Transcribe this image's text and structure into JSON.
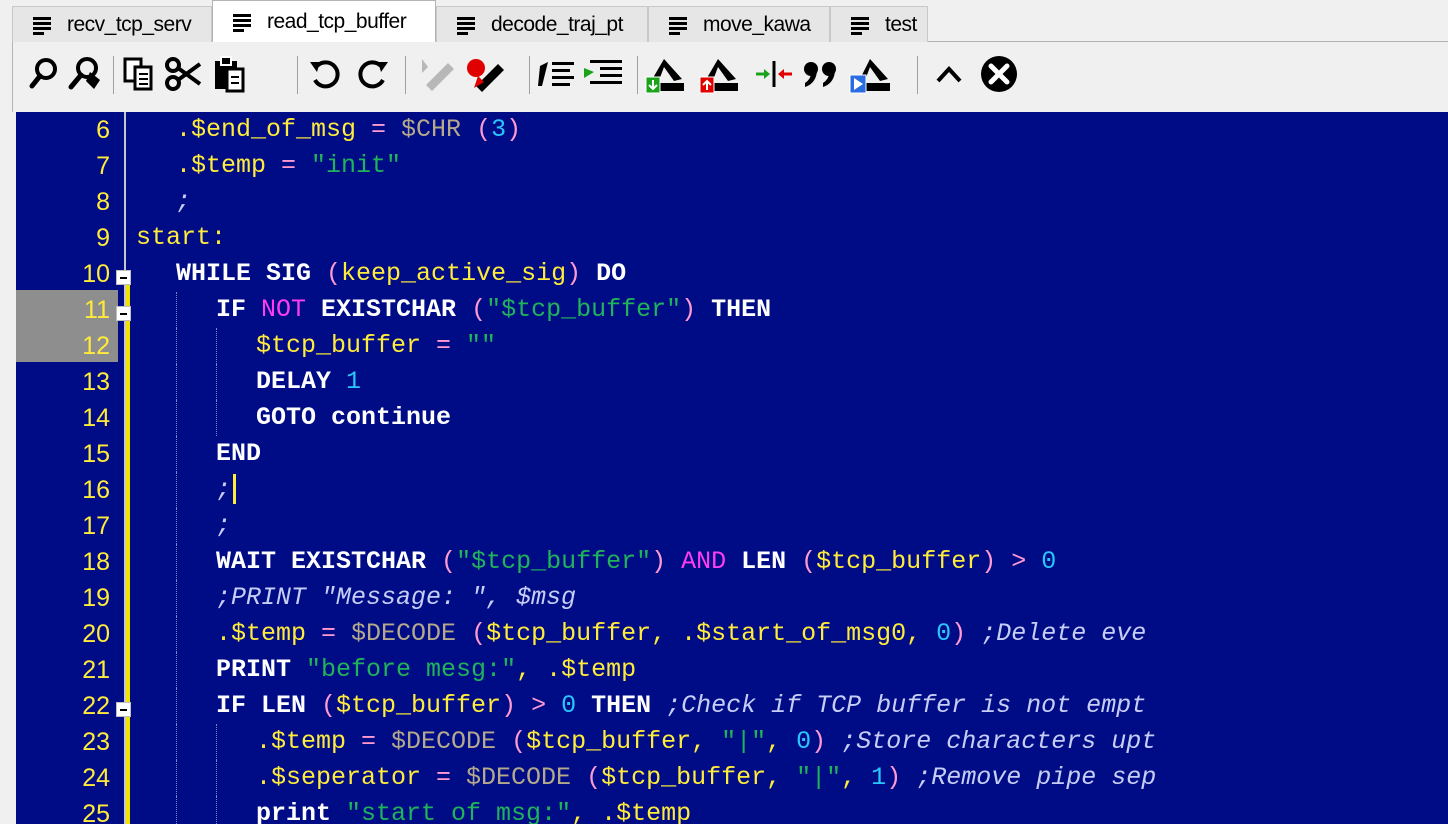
{
  "tabs": [
    {
      "label": "recv_tcp_serv",
      "active": false
    },
    {
      "label": "read_tcp_buffer",
      "active": true
    },
    {
      "label": "decode_traj_pt",
      "active": false
    },
    {
      "label": "move_kawa",
      "active": false
    },
    {
      "label": "test",
      "active": false
    }
  ],
  "toolbar": {
    "icons": [
      "find-icon",
      "find-replace-icon",
      "copy-icon",
      "cut-icon",
      "paste-icon",
      "undo-icon",
      "redo-icon",
      "highlighter-disabled-icon",
      "highlighter-icon",
      "indent-icon",
      "outdent-icon",
      "robot-insert-icon",
      "robot-remove-icon",
      "split-icon",
      "quote-icon",
      "robot-play-icon",
      "chevron-up-icon",
      "close-circle-icon"
    ]
  },
  "colors": {
    "editor_bg": "#000c86",
    "keyword": "#ffffff",
    "variable": "#ffeb3b",
    "string": "#1fb35a",
    "number": "#29c6ff",
    "comment": "#c7cef5",
    "function": "#b4a98a",
    "operator_not": "#ff3cf0"
  },
  "editor": {
    "lines": [
      {
        "n": "6",
        "indent": 1,
        "tokens": [
          {
            "t": ".$end_of_msg",
            "c": "var"
          },
          {
            "t": " = ",
            "c": "op"
          },
          {
            "t": "$CHR",
            "c": "fn"
          },
          {
            "t": " (",
            "c": "op"
          },
          {
            "t": "3",
            "c": "num"
          },
          {
            "t": ")",
            "c": "op"
          }
        ]
      },
      {
        "n": "7",
        "indent": 1,
        "tokens": [
          {
            "t": ".$temp",
            "c": "var"
          },
          {
            "t": " = ",
            "c": "op"
          },
          {
            "t": "\"init\"",
            "c": "str"
          }
        ]
      },
      {
        "n": "8",
        "indent": 1,
        "tokens": [
          {
            "t": ";",
            "c": "comment"
          }
        ]
      },
      {
        "n": "9",
        "indent": 0,
        "tokens": [
          {
            "t": "start:",
            "c": "label"
          }
        ]
      },
      {
        "n": "10",
        "indent": 1,
        "fold": true,
        "tokens": [
          {
            "t": "WHILE SIG",
            "c": "kw"
          },
          {
            "t": " (",
            "c": "op"
          },
          {
            "t": "keep_active_sig",
            "c": "var"
          },
          {
            "t": ") ",
            "c": "op"
          },
          {
            "t": "DO",
            "c": "kw"
          }
        ]
      },
      {
        "n": "11",
        "indent": 2,
        "fold": true,
        "tokens": [
          {
            "t": "IF ",
            "c": "kw"
          },
          {
            "t": "NOT",
            "c": "not"
          },
          {
            "t": " EXISTCHAR",
            "c": "kw"
          },
          {
            "t": " (",
            "c": "op"
          },
          {
            "t": "\"$tcp_buffer\"",
            "c": "str"
          },
          {
            "t": ") ",
            "c": "op"
          },
          {
            "t": "THEN",
            "c": "kw"
          }
        ]
      },
      {
        "n": "12",
        "indent": 3,
        "tokens": [
          {
            "t": "$tcp_buffer",
            "c": "var"
          },
          {
            "t": " = ",
            "c": "op"
          },
          {
            "t": "\"\"",
            "c": "str"
          }
        ]
      },
      {
        "n": "13",
        "indent": 3,
        "tokens": [
          {
            "t": "DELAY",
            "c": "kw"
          },
          {
            "t": " ",
            "c": "plain"
          },
          {
            "t": "1",
            "c": "num"
          }
        ]
      },
      {
        "n": "14",
        "indent": 3,
        "tokens": [
          {
            "t": "GOTO",
            "c": "kw"
          },
          {
            "t": " continue",
            "c": "kw"
          }
        ]
      },
      {
        "n": "15",
        "indent": 2,
        "tokens": [
          {
            "t": "END",
            "c": "kw"
          }
        ]
      },
      {
        "n": "16",
        "indent": 2,
        "caret": true,
        "tokens": [
          {
            "t": ";",
            "c": "comment"
          }
        ]
      },
      {
        "n": "17",
        "indent": 2,
        "tokens": [
          {
            "t": ";",
            "c": "comment"
          }
        ]
      },
      {
        "n": "18",
        "indent": 2,
        "tokens": [
          {
            "t": "WAIT EXISTCHAR",
            "c": "kw"
          },
          {
            "t": " (",
            "c": "op"
          },
          {
            "t": "\"$tcp_buffer\"",
            "c": "str"
          },
          {
            "t": ") ",
            "c": "op"
          },
          {
            "t": "AND",
            "c": "not"
          },
          {
            "t": " LEN",
            "c": "kw"
          },
          {
            "t": " (",
            "c": "op"
          },
          {
            "t": "$tcp_buffer",
            "c": "var"
          },
          {
            "t": ") > ",
            "c": "op"
          },
          {
            "t": "0",
            "c": "num"
          }
        ]
      },
      {
        "n": "19",
        "indent": 2,
        "tokens": [
          {
            "t": ";PRINT \"Message: \", $msg",
            "c": "comment"
          }
        ]
      },
      {
        "n": "20",
        "indent": 2,
        "tokens": [
          {
            "t": ".$temp",
            "c": "var"
          },
          {
            "t": " = ",
            "c": "op"
          },
          {
            "t": "$DECODE",
            "c": "fn"
          },
          {
            "t": " (",
            "c": "op"
          },
          {
            "t": "$tcp_buffer, .$start_of_msg0, ",
            "c": "var"
          },
          {
            "t": "0",
            "c": "num"
          },
          {
            "t": ") ",
            "c": "op"
          },
          {
            "t": ";Delete eve",
            "c": "comment"
          }
        ]
      },
      {
        "n": "21",
        "indent": 2,
        "tokens": [
          {
            "t": "PRINT",
            "c": "kw"
          },
          {
            "t": " ",
            "c": "plain"
          },
          {
            "t": "\"before mesg:\"",
            "c": "str"
          },
          {
            "t": ", .$temp",
            "c": "var"
          }
        ]
      },
      {
        "n": "22",
        "indent": 2,
        "fold": true,
        "tokens": [
          {
            "t": "IF LEN",
            "c": "kw"
          },
          {
            "t": " (",
            "c": "op"
          },
          {
            "t": "$tcp_buffer",
            "c": "var"
          },
          {
            "t": ") > ",
            "c": "op"
          },
          {
            "t": "0",
            "c": "num"
          },
          {
            "t": " THEN",
            "c": "kw"
          },
          {
            "t": " ;Check if TCP buffer is not empt",
            "c": "comment"
          }
        ]
      },
      {
        "n": "23",
        "indent": 3,
        "tokens": [
          {
            "t": ".$temp",
            "c": "var"
          },
          {
            "t": " = ",
            "c": "op"
          },
          {
            "t": "$DECODE",
            "c": "fn"
          },
          {
            "t": " (",
            "c": "op"
          },
          {
            "t": "$tcp_buffer, ",
            "c": "var"
          },
          {
            "t": "\"|\"",
            "c": "str"
          },
          {
            "t": ", ",
            "c": "var"
          },
          {
            "t": "0",
            "c": "num"
          },
          {
            "t": ") ",
            "c": "op"
          },
          {
            "t": ";Store characters upt",
            "c": "comment"
          }
        ]
      },
      {
        "n": "24",
        "indent": 3,
        "tokens": [
          {
            "t": ".$seperator",
            "c": "var"
          },
          {
            "t": " = ",
            "c": "op"
          },
          {
            "t": "$DECODE",
            "c": "fn"
          },
          {
            "t": " (",
            "c": "op"
          },
          {
            "t": "$tcp_buffer, ",
            "c": "var"
          },
          {
            "t": "\"|\"",
            "c": "str"
          },
          {
            "t": ", ",
            "c": "var"
          },
          {
            "t": "1",
            "c": "num"
          },
          {
            "t": ") ",
            "c": "op"
          },
          {
            "t": ";Remove pipe sep",
            "c": "comment"
          }
        ]
      },
      {
        "n": "25",
        "indent": 3,
        "tokens": [
          {
            "t": "print",
            "c": "kw"
          },
          {
            "t": " ",
            "c": "plain"
          },
          {
            "t": "\"start of msg:\"",
            "c": "str"
          },
          {
            "t": ", .$temp",
            "c": "var"
          }
        ]
      }
    ]
  }
}
